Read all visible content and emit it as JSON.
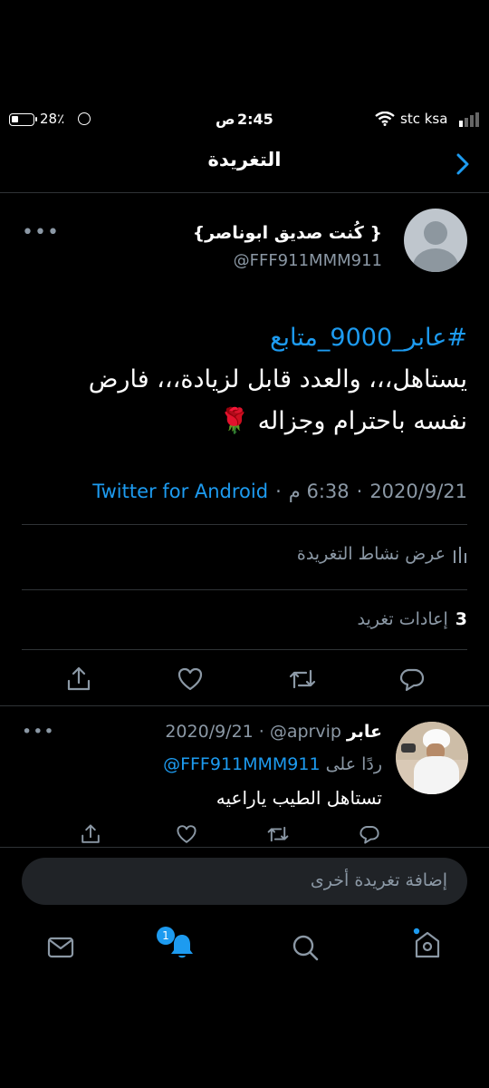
{
  "status_bar": {
    "battery": "28٪",
    "time": "2:45",
    "time_suffix": "ص",
    "carrier": "stc ksa"
  },
  "header": {
    "title": "التغريدة"
  },
  "tweet": {
    "display_name": "{ كُنت صديق ابوناصر}",
    "handle": "@FFF911MMM911",
    "hashtag": "#عابر_9000_متابع",
    "body_line1": "يستاهل،،، والعدد قابل لزيادة،،، فارض",
    "body_line2": "نفسه باحترام وجزاله",
    "emoji": "🌹",
    "date": "2020/9/21",
    "time": "6:38 م",
    "source": "Twitter for Android",
    "activity_label": "عرض نشاط التغريدة",
    "retweets_count": "3",
    "retweets_label": "إعادات تغريد"
  },
  "reply": {
    "name": "عابر",
    "handle": "@aprvip",
    "date": "2020/9/21",
    "replying_to_prefix": "ردًا على",
    "replying_to_handle": "@FFF911MMM911",
    "text": "تستاهل الطيب ياراعيه"
  },
  "composer": {
    "placeholder": "إضافة تغريدة أخرى"
  },
  "nav": {
    "notifications_badge": "1"
  },
  "colors": {
    "accent": "#1d9bf0",
    "background": "#000000",
    "muted": "#8b98a5"
  }
}
